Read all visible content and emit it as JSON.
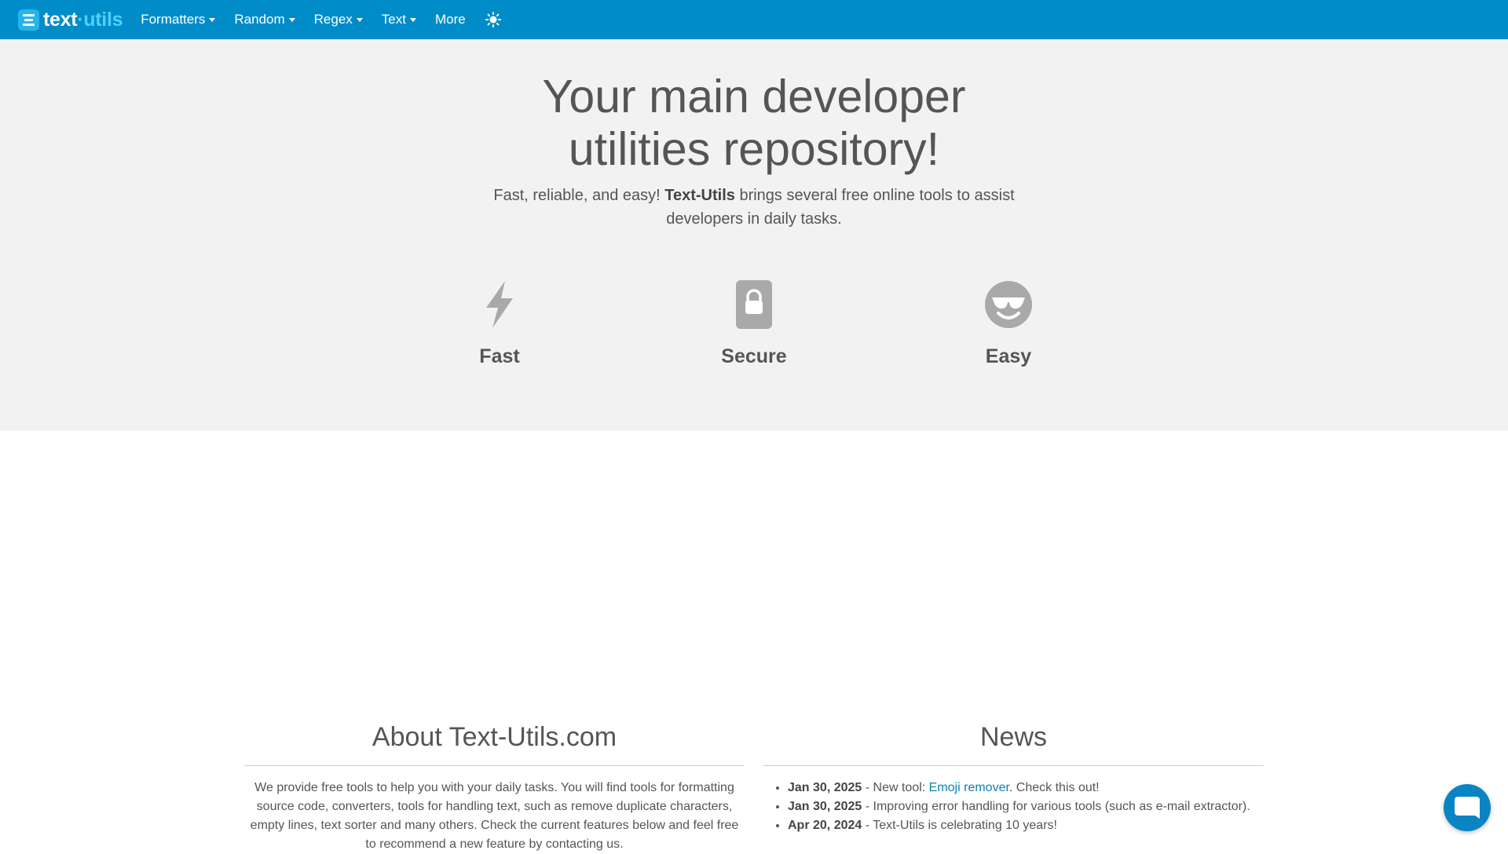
{
  "navbar": {
    "brand_part1": "text",
    "brand_dot": "·",
    "brand_part2": "utils",
    "items": [
      {
        "label": "Formatters",
        "dropdown": true
      },
      {
        "label": "Random",
        "dropdown": true
      },
      {
        "label": "Regex",
        "dropdown": true
      },
      {
        "label": "Text",
        "dropdown": true
      },
      {
        "label": "More",
        "dropdown": false
      }
    ],
    "theme_toggle_icon": "sun-icon",
    "background_color": "#008cc9"
  },
  "hero": {
    "title_line1": "Your main developer",
    "title_line2": "utilities repository!",
    "subtitle_pre": "Fast, reliable, and easy! ",
    "subtitle_brand": "Text-Utils",
    "subtitle_post": " brings several free online tools to assist developers in daily tasks.",
    "features": [
      {
        "label": "Fast",
        "icon": "lightning-bolt-icon"
      },
      {
        "label": "Secure",
        "icon": "lock-icon"
      },
      {
        "label": "Easy",
        "icon": "sunglasses-smiley-icon"
      }
    ]
  },
  "about": {
    "title": "About Text-Utils.com",
    "text": "We provide free tools to help you with your daily tasks. You will find tools for formatting source code, converters, tools for handling text, such as remove duplicate characters, empty lines, text sorter and many others. Check the current features below and feel free to recommend a new feature by contacting us."
  },
  "news": {
    "title": "News",
    "items": [
      {
        "date": "Jan 30, 2025",
        "pre": " - New tool: ",
        "link": "Emoji remover",
        "post": ". Check this out!"
      },
      {
        "date": "Jan 30, 2025",
        "pre": " - Improving error handling for various tools (such as e-mail extractor).",
        "link": "",
        "post": ""
      },
      {
        "date": "Apr 20, 2024",
        "pre": " - Text-Utils is celebrating 10 years!",
        "link": "",
        "post": ""
      }
    ]
  },
  "chat": {
    "icon": "chat-bubble-icon"
  }
}
